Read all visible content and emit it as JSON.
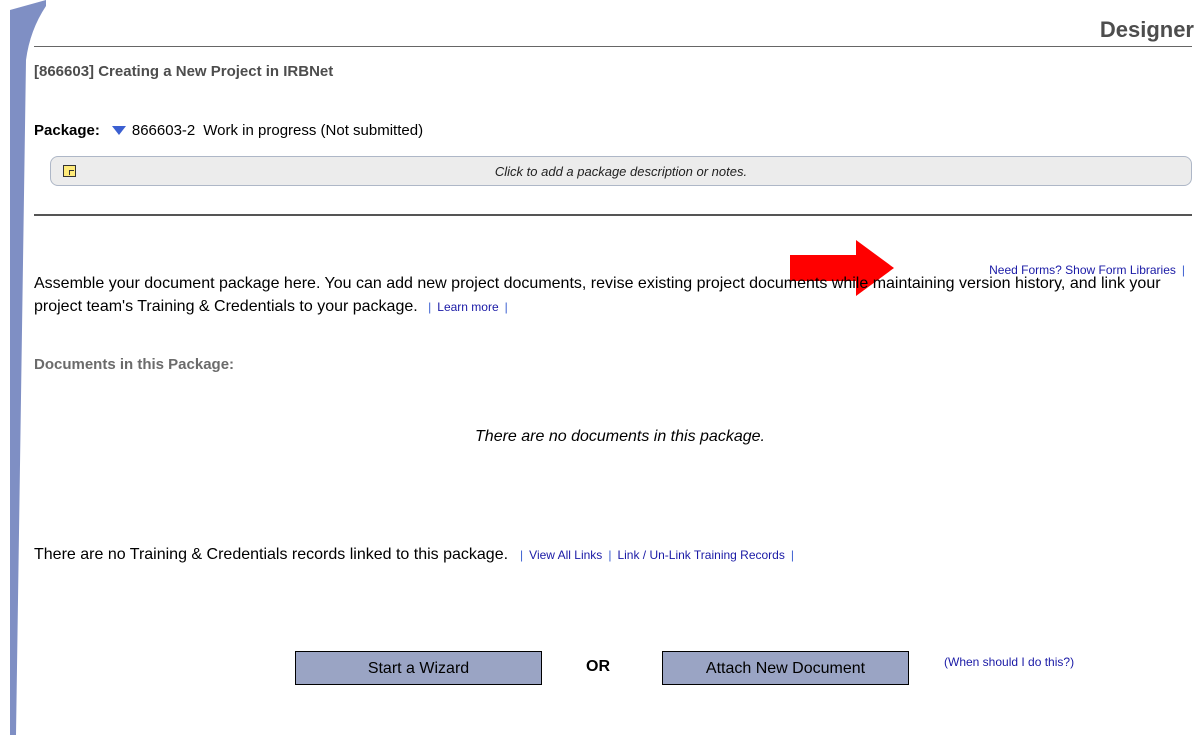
{
  "header": {
    "title": "Designer"
  },
  "project": {
    "title": "[866603] Creating a New Project in IRBNet"
  },
  "package": {
    "label": "Package:",
    "id": "866603-2",
    "status": "Work in progress (Not submitted)",
    "notes_placeholder": "Click to add a package description or notes."
  },
  "form_links": {
    "show_libraries": "Need Forms? Show Form Libraries"
  },
  "intro": {
    "text": "Assemble your document package here. You can add new project documents, revise existing project documents while maintaining version history, and link your project team's Training & Credentials to your package.",
    "learn_more": "Learn more"
  },
  "documents": {
    "heading": "Documents in this Package:",
    "empty_message": "There are no documents in this package."
  },
  "training": {
    "message": "There are no Training & Credentials records linked to this package.",
    "view_all_links": "View All Links",
    "link_unlink": "Link / Un-Link Training Records"
  },
  "actions": {
    "start_wizard": "Start a Wizard",
    "or_label": "OR",
    "attach_new_document": "Attach New Document",
    "when_link": "(When should I do this?)"
  },
  "colors": {
    "left_bar": "#7f8fc4",
    "button_bg": "#9aa4c4",
    "link": "#1a1aa6",
    "arrow": "#ff0000"
  }
}
